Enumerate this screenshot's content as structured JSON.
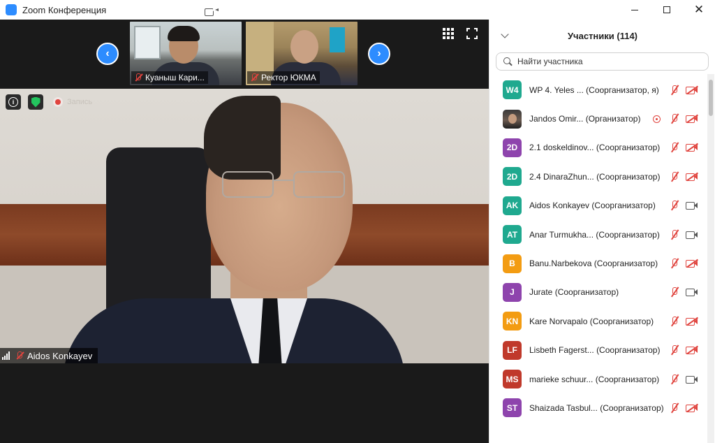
{
  "window": {
    "title": "Zoom Конференция",
    "accent": "#2d8cff"
  },
  "thumbnails": [
    {
      "name": "Куаныш Кари...",
      "muted": true
    },
    {
      "name": "Ректор ЮКМА",
      "muted": true
    }
  ],
  "recording": {
    "label": "Запись"
  },
  "speaker": {
    "name": "Aidos Konkayev",
    "muted": true
  },
  "panel": {
    "title": "Участники (114)",
    "search_placeholder": "Найти участника",
    "participants": [
      {
        "initials": "W4",
        "color": "#1fa98f",
        "name": "WP 4. Yeles ...",
        "role": "(Соорганизатор, я)",
        "mic_muted": true,
        "video_off": true,
        "sharing": false
      },
      {
        "initials": "",
        "color": "#444444",
        "name": "Jandos Omir...",
        "role": "(Организатор)",
        "mic_muted": true,
        "video_off": true,
        "sharing": true,
        "photo": true
      },
      {
        "initials": "2D",
        "color": "#8e44ad",
        "name": "2.1 doskeldinov...",
        "role": "(Соорганизатор)",
        "mic_muted": true,
        "video_off": true,
        "sharing": false
      },
      {
        "initials": "2D",
        "color": "#1fa98f",
        "name": "2.4 DinaraZhun...",
        "role": "(Соорганизатор)",
        "mic_muted": true,
        "video_off": true,
        "sharing": false
      },
      {
        "initials": "AK",
        "color": "#1fa98f",
        "name": "Aidos Konkayev",
        "role": "(Соорганизатор)",
        "mic_muted": true,
        "video_off": false,
        "sharing": false
      },
      {
        "initials": "AT",
        "color": "#1fa98f",
        "name": "Anar Turmukha...",
        "role": "(Соорганизатор)",
        "mic_muted": true,
        "video_off": false,
        "sharing": false
      },
      {
        "initials": "B",
        "color": "#f39c12",
        "name": "Banu.Narbekova",
        "role": "(Соорганизатор)",
        "mic_muted": true,
        "video_off": true,
        "sharing": false
      },
      {
        "initials": "J",
        "color": "#8e44ad",
        "name": "Jurate",
        "role": "(Соорганизатор)",
        "mic_muted": true,
        "video_off": false,
        "sharing": false
      },
      {
        "initials": "KN",
        "color": "#f39c12",
        "name": "Kare Norvapalo",
        "role": "(Соорганизатор)",
        "mic_muted": true,
        "video_off": true,
        "sharing": false
      },
      {
        "initials": "LF",
        "color": "#c0392b",
        "name": "Lisbeth Fagerst...",
        "role": "(Соорганизатор)",
        "mic_muted": true,
        "video_off": true,
        "sharing": false
      },
      {
        "initials": "MS",
        "color": "#c0392b",
        "name": "marieke schuur...",
        "role": "(Соорганизатор)",
        "mic_muted": true,
        "video_off": false,
        "sharing": false
      },
      {
        "initials": "ST",
        "color": "#8e44ad",
        "name": "Shaizada Tasbul...",
        "role": "(Соорганизатор)",
        "mic_muted": true,
        "video_off": true,
        "sharing": false
      }
    ]
  }
}
